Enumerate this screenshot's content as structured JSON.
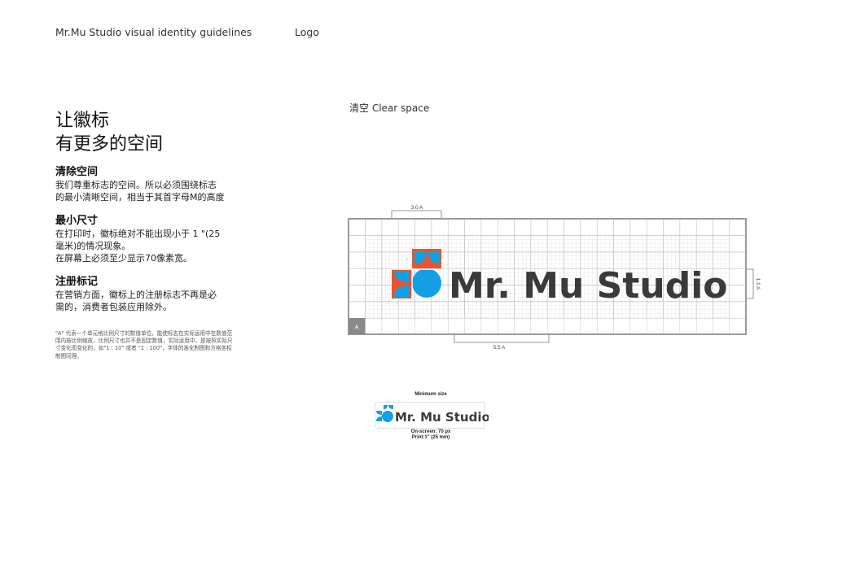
{
  "header": {
    "left_title": "Mr.Mu Studio visual identity guidelines",
    "section": "Logo"
  },
  "headline": {
    "line1": "让徽标",
    "line2": "有更多的空间"
  },
  "sections": [
    {
      "heading": "清除空间",
      "lines": [
        "我们尊重标志的空间。所以必须围绕标志",
        "的最小清晰空间，相当于其首字母M的高度"
      ]
    },
    {
      "heading": "最小尺寸",
      "lines": [
        "在打印时，徽标绝对不能出现小于 1 \"(25",
        "毫米)的情况现象。",
        "在屏幕上必须至少显示70像素宽。"
      ]
    },
    {
      "heading": "注册标记",
      "lines": [
        "在营销方面，徽标上的注册标志不再是必",
        "需的，消费者包装应用除外。"
      ]
    }
  ],
  "footnote": "\"A\" 代表一个单元格比例尺寸的数值单位，能使标志在实际运用中在数值范围内按比例缩放，比例尺寸也并不是固定数值，实际运用中，是按照实际尺寸变化而变化的，如\"1 : 10\" 或者 \"1 : 100\"，字体的准化制图和方格坐标制图同理。",
  "clear_space": {
    "caption": "清空 Clear space",
    "dim_top": "3.0 A",
    "dim_bottom": "5.5 A",
    "dim_right": "1.1 A",
    "unit_label": "A"
  },
  "logo": {
    "wordmark": "Mr. Mu Studio"
  },
  "minimum_size": {
    "title": "Minimum size",
    "wordmark": "Mr. Mu Studio",
    "screen": "On-screen: 70 px",
    "print": "Print:1\" (25 mm)"
  },
  "colors": {
    "logo_blue": "#139fe3",
    "logo_orange": "#e4572e",
    "wordmark": "#3a3a3a",
    "grid": "#bdbdbd",
    "frame": "#9a9a9a"
  }
}
